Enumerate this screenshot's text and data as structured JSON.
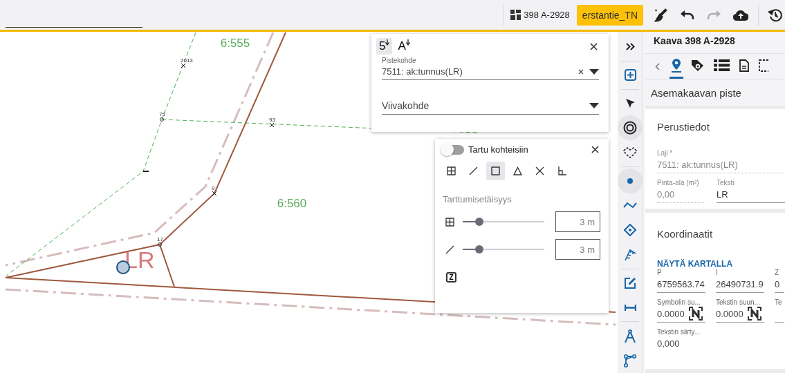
{
  "top_bar": {
    "plan": "398 A-2928",
    "user": "erstantie_TN",
    "actions": [
      {
        "kind": "clean",
        "disabled": false
      },
      {
        "kind": "undo",
        "disabled": false
      },
      {
        "kind": "redo",
        "disabled": true
      },
      {
        "kind": "upload",
        "disabled": false
      },
      {
        "kind": "history",
        "disabled": false
      }
    ]
  },
  "map": {
    "area_labels": [
      "6:555",
      "6:560"
    ],
    "points": [
      {
        "number": "2013",
        "kind": "cross"
      },
      {
        "number": "75",
        "kind": "circle"
      },
      {
        "number": "93",
        "kind": "cross"
      },
      {
        "number": "9",
        "kind": "cross"
      },
      {
        "number": "17",
        "kind": "circle"
      }
    ],
    "symbol_label": "LR"
  },
  "feature_popup": {
    "modes": [
      {
        "label": "5",
        "selected": true
      },
      {
        "label": "A",
        "selected": false
      }
    ],
    "point_field": {
      "label": "Pistekohde",
      "value": "7511: ak:tunnus(LR)"
    },
    "line_field": {
      "placeholder": "Viivakohde"
    }
  },
  "snap_popup": {
    "toggle_label": "Tartu kohteisiin",
    "on": false,
    "snap_types": [
      {
        "kind": "grid",
        "selected": false
      },
      {
        "kind": "line",
        "selected": false
      },
      {
        "kind": "square",
        "selected": true
      },
      {
        "kind": "triangle",
        "selected": false
      },
      {
        "kind": "cross",
        "selected": false
      },
      {
        "kind": "corner",
        "selected": false
      }
    ],
    "distance_title": "Tarttumisetäisyys",
    "distances": [
      {
        "kind": "grid",
        "level": 0.2,
        "value": "3 m"
      },
      {
        "kind": "line",
        "level": 0.2,
        "value": "3 m"
      }
    ],
    "z_key": "Z"
  },
  "toolbar": {
    "groups": [
      [
        {
          "kind": "expand",
          "selected": false
        }
      ],
      [
        {
          "kind": "add",
          "selected": false
        }
      ],
      [
        {
          "kind": "pointer",
          "selected": false
        },
        {
          "kind": "target",
          "selected": true
        },
        {
          "kind": "area",
          "selected": false
        }
      ],
      [
        {
          "kind": "point",
          "selected": true
        },
        {
          "kind": "line",
          "selected": false
        },
        {
          "kind": "tag",
          "selected": false
        },
        {
          "kind": "slope",
          "selected": false
        }
      ],
      [
        {
          "kind": "edit",
          "selected": false
        },
        {
          "kind": "measure",
          "selected": false
        }
      ],
      [
        {
          "kind": "compass",
          "selected": false
        },
        {
          "kind": "branch",
          "selected": false
        }
      ]
    ]
  },
  "right_panel": {
    "title": "Kaava 398 A-2928",
    "tabs": [
      {
        "kind": "location",
        "selected": true
      },
      {
        "kind": "tags",
        "selected": false
      },
      {
        "kind": "list",
        "selected": false
      },
      {
        "kind": "document",
        "selected": false
      },
      {
        "kind": "selection",
        "selected": false
      }
    ],
    "subtitle": "Asemakaavan piste",
    "basic": {
      "title": "Perustiedot",
      "type_label": "Laji *",
      "type_value": "7511: ak:tunnus(LR)",
      "fields": [
        {
          "label": "Pinta-ala (m²)",
          "value": "0,00",
          "kind": "readonly"
        },
        {
          "label": "Teksti",
          "value": "LR",
          "kind": "input"
        }
      ]
    },
    "coordinates": {
      "title": "Koordinaatit",
      "link": "NÄYTÄ KARTALLA",
      "rows": [
        [
          {
            "label": "P",
            "value": "6759563.74",
            "kind": "number"
          },
          {
            "label": "I",
            "value": "26490731.9",
            "kind": "number"
          },
          {
            "label": "Z",
            "value": "0",
            "kind": "number"
          }
        ],
        [
          {
            "label": "Symbolin su...",
            "value": "0.0000",
            "kind": "angle"
          },
          {
            "label": "Tekstin suun...",
            "value": "0.0000",
            "kind": "angle"
          },
          {
            "label": "Te",
            "kind": "number"
          }
        ],
        [
          {
            "label": "Tekstin siirty...",
            "value": "0,000",
            "kind": "number"
          }
        ]
      ]
    }
  }
}
